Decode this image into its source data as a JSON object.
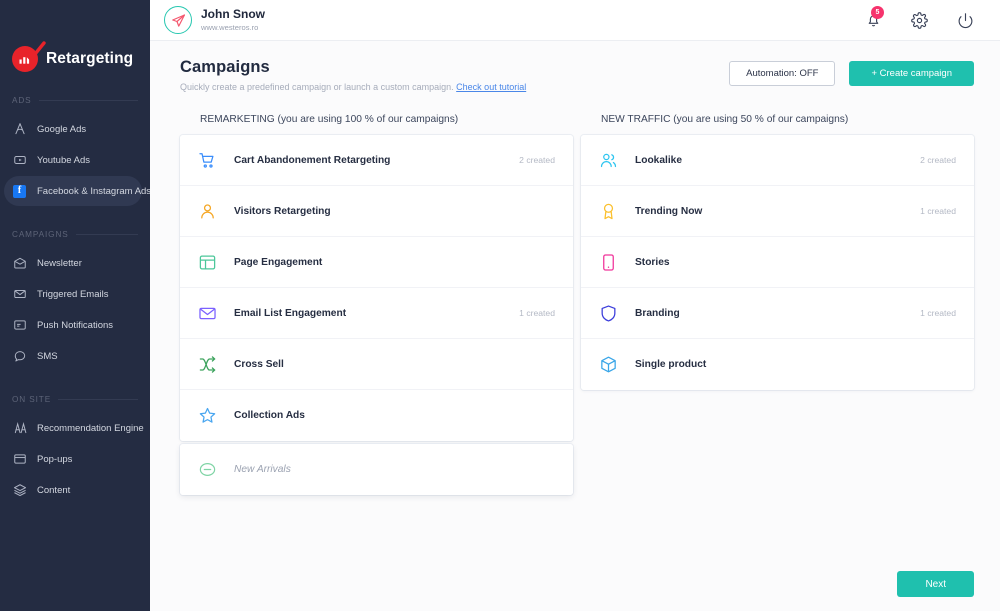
{
  "brand": {
    "name": "Retargeting",
    "logo_icon": "bar-chart-circle-icon",
    "logo_color": "#e8232a"
  },
  "sidebar": {
    "sections": [
      {
        "heading": "ADS",
        "items": [
          {
            "label": "Google Ads",
            "icon": "google-ads-icon",
            "active": false
          },
          {
            "label": "Youtube Ads",
            "icon": "youtube-icon",
            "active": false
          },
          {
            "label": "Facebook & Instagram Ads",
            "icon": "facebook-icon",
            "active": true
          }
        ]
      },
      {
        "heading": "CAMPAIGNS",
        "items": [
          {
            "label": "Newsletter",
            "icon": "mail-open-icon",
            "active": false
          },
          {
            "label": "Triggered Emails",
            "icon": "envelope-icon",
            "active": false
          },
          {
            "label": "Push Notifications",
            "icon": "push-notification-icon",
            "active": false
          },
          {
            "label": "SMS",
            "icon": "chat-bubble-icon",
            "active": false
          }
        ]
      },
      {
        "heading": "ON SITE",
        "items": [
          {
            "label": "Recommendation Engine",
            "icon": "recommendation-icon",
            "active": false
          },
          {
            "label": "Pop-ups",
            "icon": "popup-window-icon",
            "active": false
          },
          {
            "label": "Content",
            "icon": "layers-icon",
            "active": false
          }
        ]
      }
    ]
  },
  "topbar": {
    "user_name": "John Snow",
    "user_url": "www.westeros.ro",
    "avatar_icon": "paper-plane-icon",
    "avatar_ring_color": "#27c7b0",
    "notification_count": "5",
    "notification_badge_color": "#f6336d",
    "icons": [
      "bell-icon",
      "gear-icon",
      "power-icon"
    ]
  },
  "page": {
    "title": "Campaigns",
    "subtitle": "Quickly create a predefined campaign or launch a custom campaign.",
    "tutorial_link": "Check out tutorial",
    "automation_button": "Automation: OFF",
    "create_button": "+ Create campaign",
    "next_button": "Next",
    "accent_color": "#1fc0ae"
  },
  "columns": [
    {
      "heading": "REMARKETING (you are using 100 % of our campaigns)",
      "items": [
        {
          "label": "Cart Abandonement Retargeting",
          "count": "2 created",
          "icon": "shopping-cart-icon",
          "color": "#3a8dfb",
          "disabled": false
        },
        {
          "label": "Visitors Retargeting",
          "count": "",
          "icon": "user-icon",
          "color": "#f5a623",
          "disabled": false
        },
        {
          "label": "Page Engagement",
          "count": "",
          "icon": "layout-icon",
          "color": "#4cc79a",
          "disabled": false
        },
        {
          "label": "Email List Engagement",
          "count": "1 created",
          "icon": "envelope-icon",
          "color": "#7b61ff",
          "disabled": false
        },
        {
          "label": "Cross Sell",
          "count": "",
          "icon": "shuffle-icon",
          "color": "#3da35d",
          "disabled": false
        },
        {
          "label": "Collection Ads",
          "count": "",
          "icon": "star-icon",
          "color": "#49a6f0",
          "disabled": false
        },
        {
          "label": "New Arrivals",
          "count": "",
          "icon": "minus-circle-icon",
          "color": "#7fd4a5",
          "disabled": true
        }
      ]
    },
    {
      "heading": "NEW TRAFFIC (you are using 50 % of our campaigns)",
      "items": [
        {
          "label": "Lookalike",
          "count": "2 created",
          "icon": "users-icon",
          "color": "#2ec5f0",
          "disabled": false
        },
        {
          "label": "Trending Now",
          "count": "1 created",
          "icon": "award-icon",
          "color": "#fbc02d",
          "disabled": false
        },
        {
          "label": "Stories",
          "count": "",
          "icon": "mobile-story-icon",
          "color": "#f0349a",
          "disabled": false
        },
        {
          "label": "Branding",
          "count": "1 created",
          "icon": "shield-icon",
          "color": "#3b3ddb",
          "disabled": false
        },
        {
          "label": "Single product",
          "count": "",
          "icon": "package-box-icon",
          "color": "#3aa6e8",
          "disabled": false
        }
      ]
    }
  ]
}
